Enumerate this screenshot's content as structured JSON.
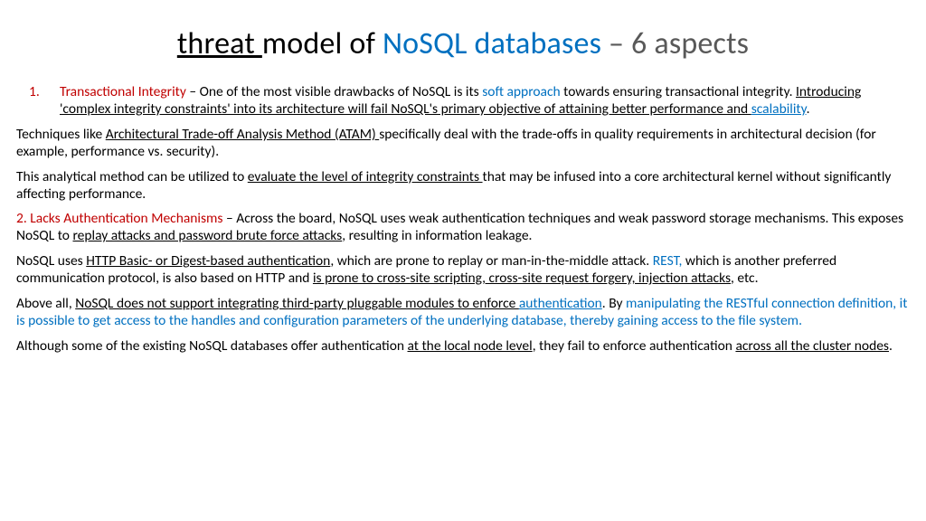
{
  "title": {
    "p1": "threat ",
    "p2": "model of ",
    "p3": "NoSQL databases ",
    "p4": "– 6 aspects"
  },
  "item1": {
    "num": "1.",
    "lead": "Transactional Integrity ",
    "t1": "– One of the most visible drawbacks of NoSQL is its ",
    "soft": "soft approach ",
    "t2": "towards ensuring transactional integrity. ",
    "u1a": "Introducing 'complex integrity constraints' into its architecture will fail NoSQL's primary objective of attaining better performance and ",
    "u1b": "scalability",
    "t3": "."
  },
  "p2": {
    "t1": "Techniques like ",
    "u1": "Architectural Trade-off Analysis Method (ATAM) ",
    "t2": "specifically deal with the trade-offs in quality requirements in architectural decision (for example, performance vs. security)."
  },
  "p3": {
    "t1": "This analytical method can be utilized to ",
    "u1": "evaluate the level of integrity constraints ",
    "t2": "that may be infused into a core architectural kernel without significantly affecting performance."
  },
  "p4": {
    "lead": "2. Lacks Authentication Mechanisms ",
    "t1": "– Across the board, NoSQL uses weak authentication techniques and weak password storage mechanisms. This exposes NoSQL to ",
    "u1": "replay attacks and password brute force attacks",
    "t2": ", resulting in information leakage."
  },
  "p5": {
    "t1": "NoSQL uses ",
    "u1": "HTTP Basic- or Digest-based authentication",
    "t2": ", which are prone to replay or man-in-the-middle attack. ",
    "rest": "REST, ",
    "t3": "which is another preferred communication protocol, is also based on HTTP and ",
    "u2": "is prone to cross-site scripting, cross-site request forgery, injection attacks",
    "t4": ", etc."
  },
  "p6": {
    "t1": "Above all, ",
    "u1": "NoSQL does not support integrating third-party pluggable modules to enforce ",
    "u1b": "authentication",
    "t2": ". By ",
    "blue": "manipulating the RESTful connection definition, it is possible to get access to the handles and configuration parameters of the underlying database, thereby gaining access to the file system."
  },
  "p7": {
    "t1": "Although some of the existing NoSQL databases offer authentication ",
    "u1": "at the local node level",
    "t2": ", they fail to enforce authentication ",
    "u2": "across all the cluster nodes",
    "t3": "."
  }
}
